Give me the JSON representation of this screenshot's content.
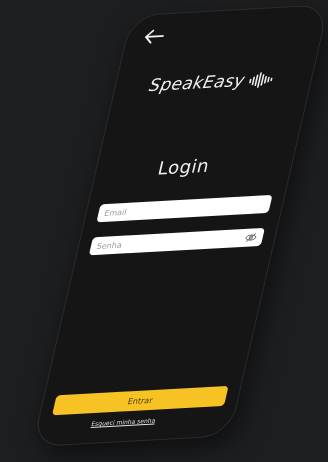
{
  "app": {
    "name": "SpeakEasy"
  },
  "header": {
    "back_icon": "arrow-left-icon"
  },
  "logo": {
    "text": "SpeakEasy",
    "icon": "sound-wave-icon"
  },
  "login": {
    "title": "Login",
    "email_placeholder": "Email",
    "password_placeholder": "Senha",
    "password_toggle_icon": "eye-off-icon",
    "submit_label": "Entrar",
    "forgot_label": "Esqueci minha senha"
  },
  "colors": {
    "background": "#1d1e20",
    "phone": "#151516",
    "accent": "#f6c224",
    "input": "#ffffff",
    "text": "#f0f0f0"
  }
}
